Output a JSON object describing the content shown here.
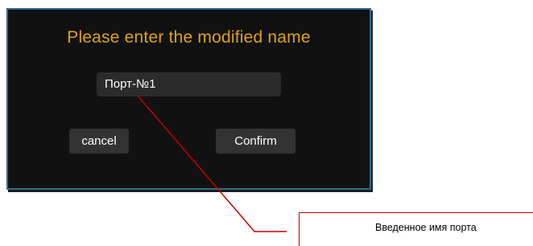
{
  "dialog": {
    "title": "Please enter the modified name",
    "input_value": "Порт-№1",
    "cancel_label": "cancel",
    "confirm_label": "Confirm"
  },
  "annotation": {
    "text": "Введенное имя порта",
    "line_color": "#c40000"
  },
  "colors": {
    "dialog_background": "#111111",
    "dialog_border": "#2f6e8e",
    "title": "#e0a21c",
    "button_background": "#333333",
    "input_background": "#2b2b2b"
  }
}
